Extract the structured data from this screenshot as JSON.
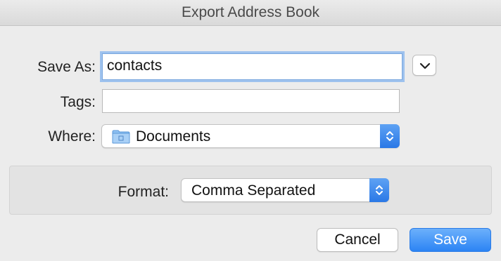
{
  "window": {
    "title": "Export Address Book"
  },
  "save_as": {
    "label": "Save As:",
    "value": "contacts",
    "expand_icon": "chevron-down-icon"
  },
  "tags": {
    "label": "Tags:",
    "value": ""
  },
  "where": {
    "label": "Where:",
    "value": "Documents",
    "icon": "folder-icon"
  },
  "format": {
    "label": "Format:",
    "value": "Comma Separated"
  },
  "buttons": {
    "cancel": "Cancel",
    "save": "Save"
  },
  "colors": {
    "accent": "#2c84f4",
    "focus_ring": "#9ec2ee",
    "background": "#ececec"
  }
}
